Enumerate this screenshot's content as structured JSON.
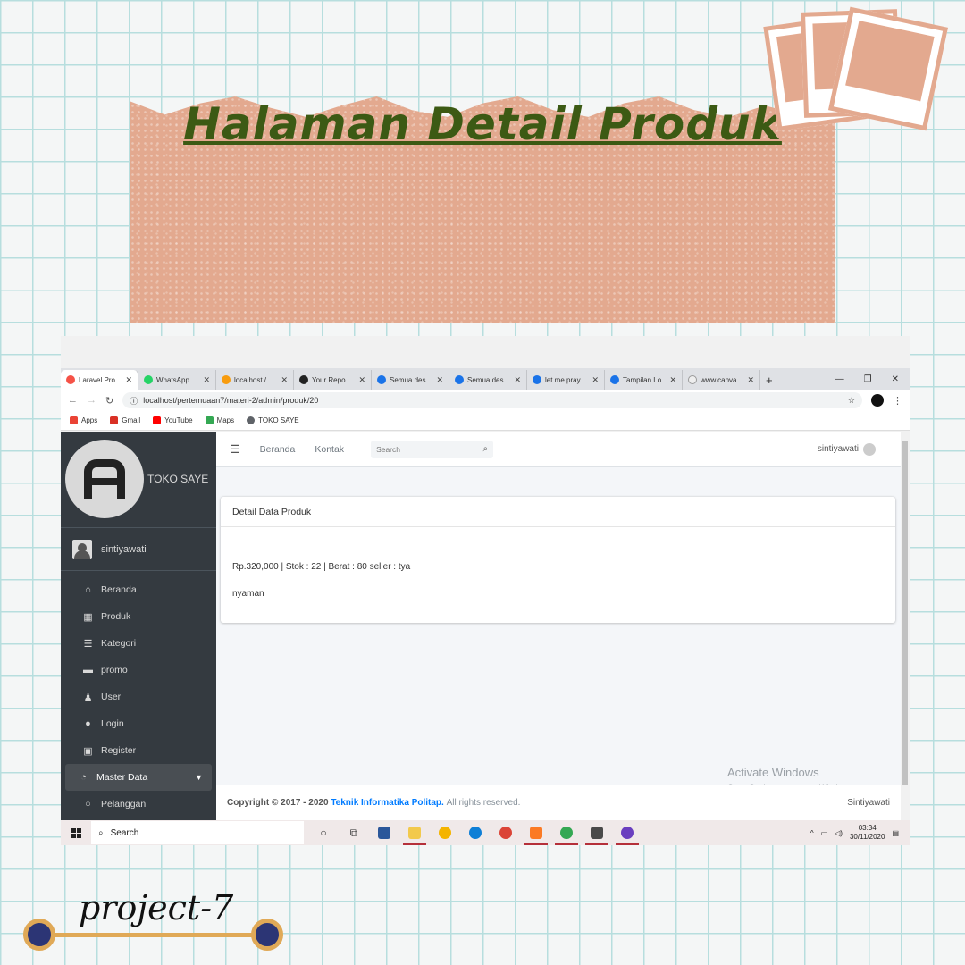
{
  "banner": {
    "title": "Halaman  Detail Produk"
  },
  "project_label": "project-7",
  "browser": {
    "tabs": [
      {
        "label": "Laravel Pro",
        "icon": "laravel-icon",
        "color": "#f55247",
        "active": true
      },
      {
        "label": "WhatsApp",
        "icon": "whatsapp-icon",
        "color": "#25d366",
        "active": false
      },
      {
        "label": "localhost /",
        "icon": "phpmyadmin-icon",
        "color": "#f89c0e",
        "active": false
      },
      {
        "label": "Your Repo",
        "icon": "github-icon",
        "color": "#222222",
        "active": false
      },
      {
        "label": "Semua des",
        "icon": "canva-icon",
        "color": "#1a73e8",
        "active": false
      },
      {
        "label": "Semua des",
        "icon": "canva-icon",
        "color": "#1a73e8",
        "active": false
      },
      {
        "label": "let me pray",
        "icon": "canva-icon",
        "color": "#1a73e8",
        "active": false
      },
      {
        "label": "Tampilan Lo",
        "icon": "canva-icon",
        "color": "#1a73e8",
        "active": false
      },
      {
        "label": "www.canva",
        "icon": "loading-icon",
        "color": "#999999",
        "active": false
      }
    ],
    "url": "localhost/pertemuaan7/materi-2/admin/produk/20",
    "bookmarks": [
      {
        "label": "Apps",
        "color": "#ea4335"
      },
      {
        "label": "Gmail",
        "color": "#d93025"
      },
      {
        "label": "YouTube",
        "color": "#ff0000"
      },
      {
        "label": "Maps",
        "color": "#34a853"
      },
      {
        "label": "TOKO SAYE",
        "color": "#5f6368"
      }
    ]
  },
  "sidebar": {
    "brand": "TOKO SAYE",
    "user": "sintiyawati",
    "items": [
      {
        "label": "Beranda",
        "icon": "home-icon",
        "glyph": "⌂"
      },
      {
        "label": "Produk",
        "icon": "grid-icon",
        "glyph": "▦"
      },
      {
        "label": "Kategori",
        "icon": "list-icon",
        "glyph": "☰"
      },
      {
        "label": "promo",
        "icon": "wallet-icon",
        "glyph": "▬"
      },
      {
        "label": "User",
        "icon": "users-icon",
        "glyph": "♟"
      },
      {
        "label": "Login",
        "icon": "user-icon",
        "glyph": "●"
      },
      {
        "label": "Register",
        "icon": "address-card-icon",
        "glyph": "▣"
      },
      {
        "label": "Master Data",
        "icon": "dashboard-icon",
        "glyph": "◔",
        "active": true
      },
      {
        "label": "Pelanggan",
        "icon": "circle-icon",
        "glyph": "○"
      }
    ]
  },
  "topnav": {
    "links": [
      "Beranda",
      "Kontak"
    ],
    "search_placeholder": "Search",
    "user": "sintiyawati"
  },
  "card": {
    "title": "Detail Data Produk",
    "detail_line": "Rp.320,000 | Stok : 22 | Berat : 80 seller : tya",
    "description": "nyaman"
  },
  "footer": {
    "copyright": "Copyright © 2017 - 2020",
    "link": "Teknik Informatika Politap.",
    "rights": "All rights reserved.",
    "right": "Sintiyawati"
  },
  "watermark": {
    "title": "Activate Windows",
    "subtitle": "Go to Settings to activate Windows."
  },
  "taskbar": {
    "search": "Search",
    "time": "03:34",
    "date": "30/11/2020"
  }
}
